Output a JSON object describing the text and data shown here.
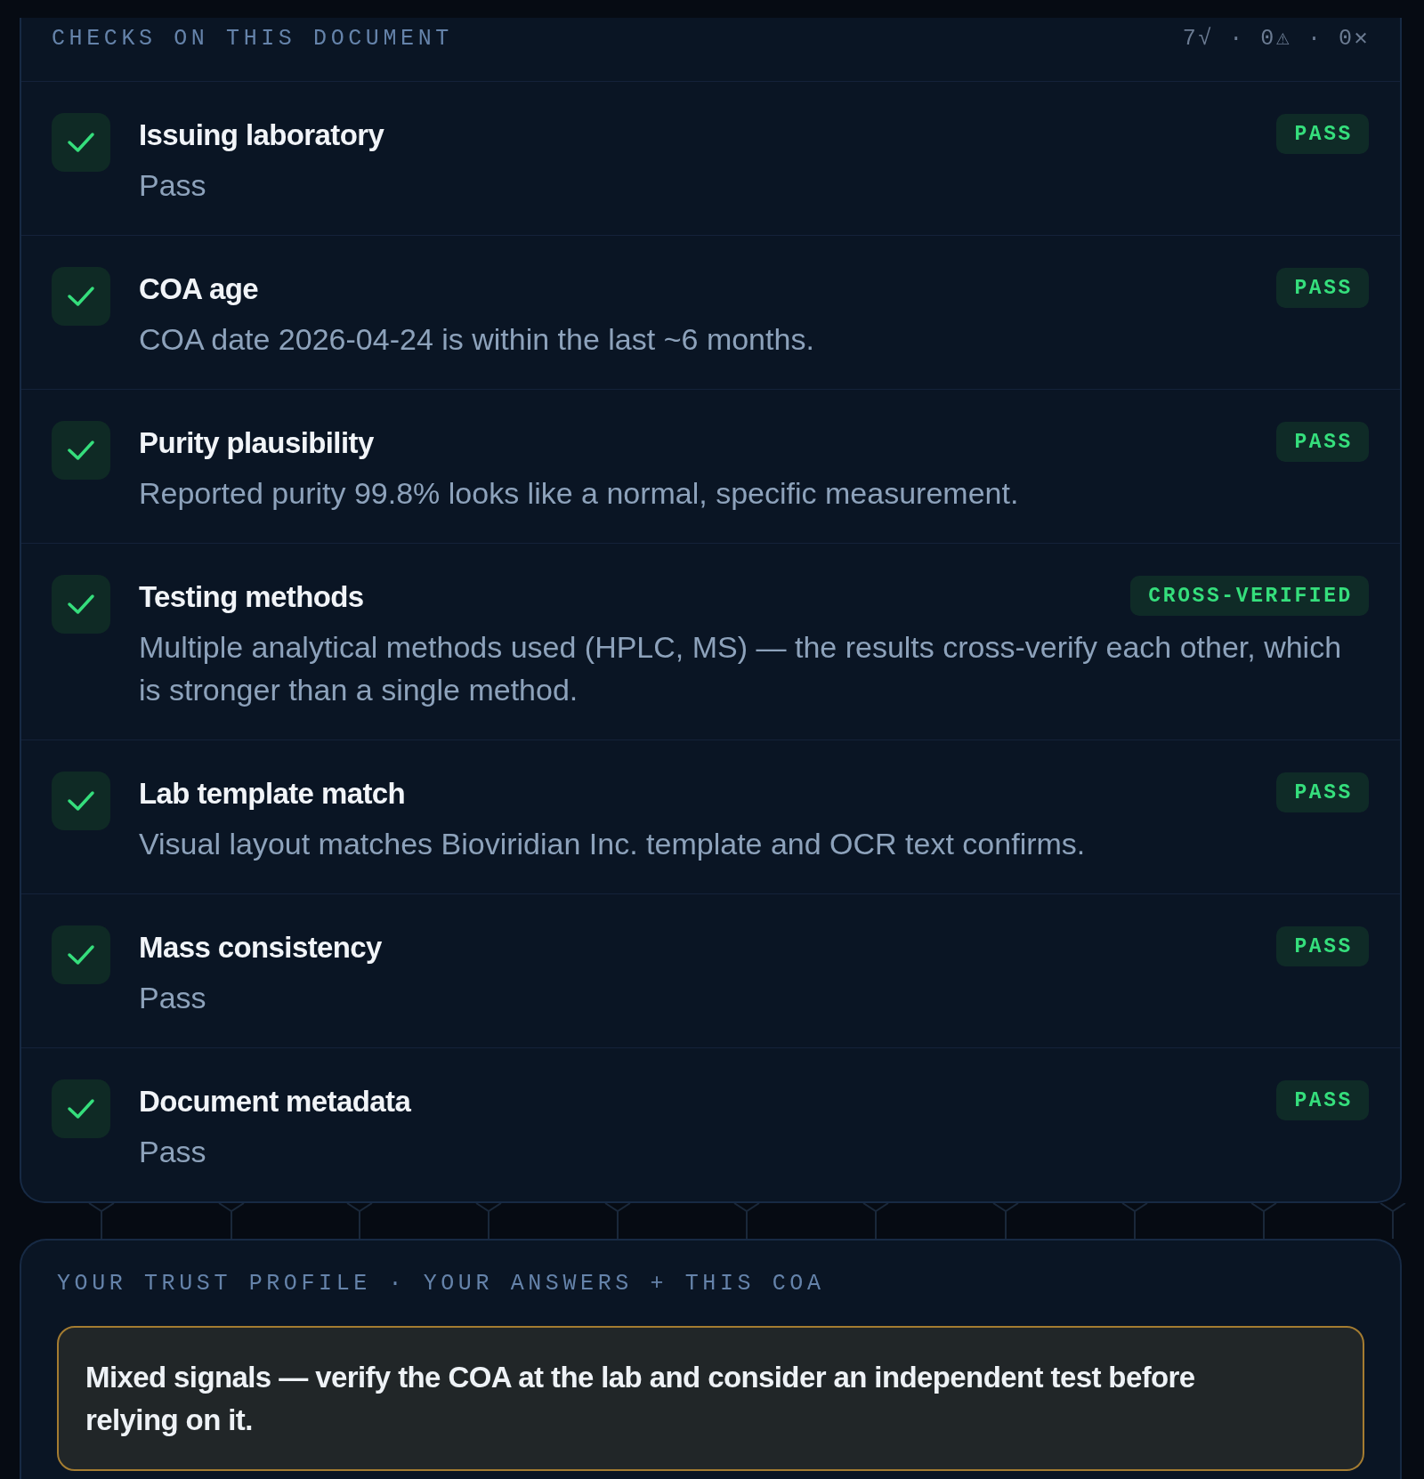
{
  "checks_card": {
    "title": "CHECKS ON THIS DOCUMENT",
    "summary": "7√ · 0⚠ · 0✕",
    "checks": [
      {
        "title": "Issuing laboratory",
        "description": "Pass",
        "passed": true,
        "badge": "PASS"
      },
      {
        "title": "COA age",
        "description": "COA date 2026-04-24 is within the last ~6 months.",
        "passed": true,
        "badge": "PASS"
      },
      {
        "title": "Purity plausibility",
        "description": "Reported purity 99.8% looks like a normal, specific measurement.",
        "passed": true,
        "badge": "PASS"
      },
      {
        "title": "Testing methods",
        "description": "Multiple analytical methods used (HPLC, MS) — the results cross-verify each other, which is stronger than a single method.",
        "passed": true,
        "badge": "CROSS-VERIFIED"
      },
      {
        "title": "Lab template match",
        "description": "Visual layout matches Bioviridian Inc. template and OCR text confirms.",
        "passed": true,
        "badge": "PASS"
      },
      {
        "title": "Mass consistency",
        "description": "Pass",
        "passed": true,
        "badge": "PASS"
      },
      {
        "title": "Document metadata",
        "description": "Pass",
        "passed": true,
        "badge": "PASS"
      }
    ]
  },
  "trust_profile": {
    "title": "YOUR TRUST PROFILE · YOUR ANSWERS + THIS COA",
    "verdict": {
      "kind": "caution",
      "text": "Mixed signals — verify the COA at the lab and consider an independent test before relying on it."
    }
  }
}
